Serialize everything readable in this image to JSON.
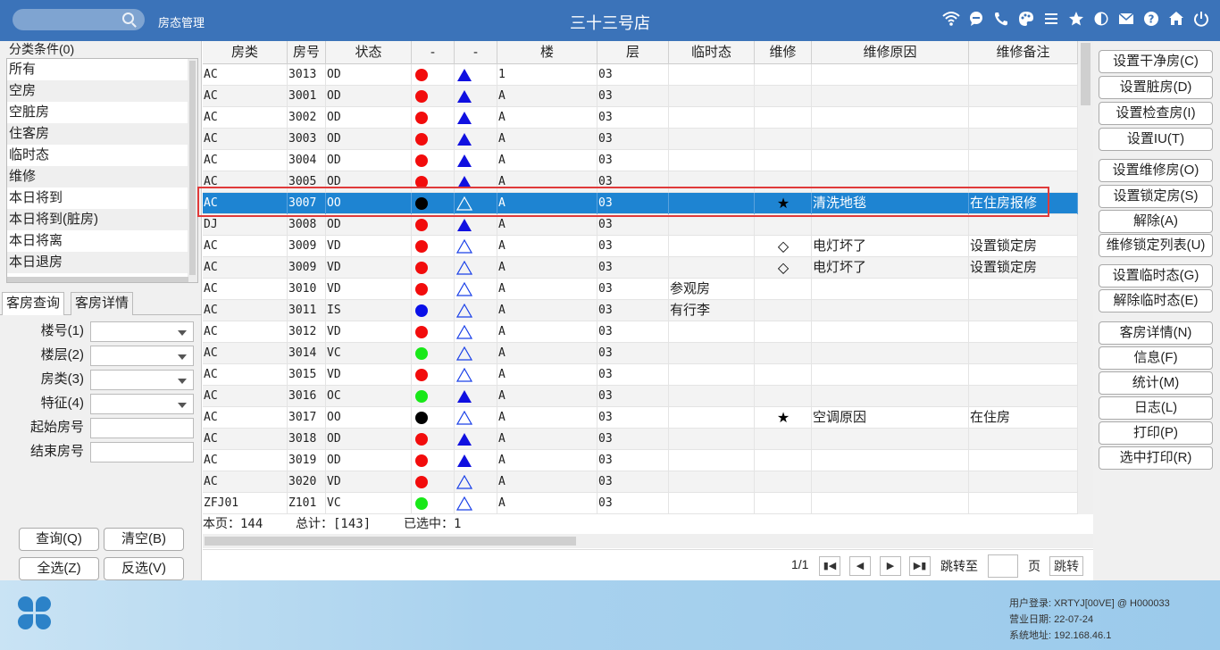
{
  "topbar": {
    "module": "房态管理",
    "store": "三十三号店",
    "icons": [
      "wifi-icon",
      "chat-icon",
      "phone-icon",
      "palette-icon",
      "menu-icon",
      "star-icon",
      "theme-icon",
      "mail-icon",
      "help-icon",
      "home-icon",
      "power-icon"
    ]
  },
  "left": {
    "category_title": "分类条件(0)",
    "categories": [
      "所有",
      "空房",
      "空脏房",
      "住客房",
      "临时态",
      "维修",
      "本日将到",
      "本日将到(脏房)",
      "本日将离",
      "本日退房"
    ],
    "tabs": [
      "客房查询",
      "客房详情"
    ],
    "fields": {
      "building": "楼号(1)",
      "floor": "楼层(2)",
      "room_type": "房类(3)",
      "feature": "特征(4)",
      "start_room": "起始房号",
      "end_room": "结束房号"
    },
    "buttons": {
      "query": "查询(Q)",
      "clear": "清空(B)",
      "select_all": "全选(Z)",
      "invert": "反选(V)"
    }
  },
  "grid": {
    "headers": [
      "房类",
      "房号",
      "状态",
      "-",
      "-",
      "楼",
      "层",
      "临时态",
      "维修",
      "维修原因",
      "维修备注"
    ],
    "rows": [
      {
        "type": "AC",
        "room": "3013",
        "status": "OD",
        "dot": "red",
        "tri": "filled",
        "building": "1",
        "floor": "03",
        "temp": "",
        "repair": "",
        "reason": "",
        "note": ""
      },
      {
        "type": "AC",
        "room": "3001",
        "status": "OD",
        "dot": "red",
        "tri": "filled",
        "building": "A",
        "floor": "03",
        "temp": "",
        "repair": "",
        "reason": "",
        "note": ""
      },
      {
        "type": "AC",
        "room": "3002",
        "status": "OD",
        "dot": "red",
        "tri": "filled",
        "building": "A",
        "floor": "03",
        "temp": "",
        "repair": "",
        "reason": "",
        "note": ""
      },
      {
        "type": "AC",
        "room": "3003",
        "status": "OD",
        "dot": "red",
        "tri": "filled",
        "building": "A",
        "floor": "03",
        "temp": "",
        "repair": "",
        "reason": "",
        "note": ""
      },
      {
        "type": "AC",
        "room": "3004",
        "status": "OD",
        "dot": "red",
        "tri": "filled",
        "building": "A",
        "floor": "03",
        "temp": "",
        "repair": "",
        "reason": "",
        "note": ""
      },
      {
        "type": "AC",
        "room": "3005",
        "status": "OD",
        "dot": "red",
        "tri": "filled",
        "building": "A",
        "floor": "03",
        "temp": "",
        "repair": "",
        "reason": "",
        "note": ""
      },
      {
        "type": "AC",
        "room": "3007",
        "status": "OO",
        "dot": "black",
        "tri": "outline",
        "building": "A",
        "floor": "03",
        "temp": "",
        "repair": "★",
        "reason": "清洗地毯",
        "note": "在住房报修",
        "selected": true
      },
      {
        "type": "DJ",
        "room": "3008",
        "status": "OD",
        "dot": "red",
        "tri": "filled",
        "building": "A",
        "floor": "03",
        "temp": "",
        "repair": "",
        "reason": "",
        "note": ""
      },
      {
        "type": "AC",
        "room": "3009",
        "status": "VD",
        "dot": "red",
        "tri": "outline",
        "building": "A",
        "floor": "03",
        "temp": "",
        "repair": "◇",
        "reason": "电灯坏了",
        "note": "设置锁定房"
      },
      {
        "type": "AC",
        "room": "3009",
        "status": "VD",
        "dot": "red",
        "tri": "outline",
        "building": "A",
        "floor": "03",
        "temp": "",
        "repair": "◇",
        "reason": "电灯坏了",
        "note": "设置锁定房"
      },
      {
        "type": "AC",
        "room": "3010",
        "status": "VD",
        "dot": "red",
        "tri": "outline",
        "building": "A",
        "floor": "03",
        "temp": "参观房",
        "repair": "",
        "reason": "",
        "note": ""
      },
      {
        "type": "AC",
        "room": "3011",
        "status": "IS",
        "dot": "blue",
        "tri": "outline",
        "building": "A",
        "floor": "03",
        "temp": "有行李",
        "repair": "",
        "reason": "",
        "note": ""
      },
      {
        "type": "AC",
        "room": "3012",
        "status": "VD",
        "dot": "red",
        "tri": "outline",
        "building": "A",
        "floor": "03",
        "temp": "",
        "repair": "",
        "reason": "",
        "note": ""
      },
      {
        "type": "AC",
        "room": "3014",
        "status": "VC",
        "dot": "green",
        "tri": "outline",
        "building": "A",
        "floor": "03",
        "temp": "",
        "repair": "",
        "reason": "",
        "note": ""
      },
      {
        "type": "AC",
        "room": "3015",
        "status": "VD",
        "dot": "red",
        "tri": "outline",
        "building": "A",
        "floor": "03",
        "temp": "",
        "repair": "",
        "reason": "",
        "note": ""
      },
      {
        "type": "AC",
        "room": "3016",
        "status": "OC",
        "dot": "green",
        "tri": "filled",
        "building": "A",
        "floor": "03",
        "temp": "",
        "repair": "",
        "reason": "",
        "note": ""
      },
      {
        "type": "AC",
        "room": "3017",
        "status": "OO",
        "dot": "black",
        "tri": "outline",
        "building": "A",
        "floor": "03",
        "temp": "",
        "repair": "★",
        "reason": "空调原因",
        "note": "在住房"
      },
      {
        "type": "AC",
        "room": "3018",
        "status": "OD",
        "dot": "red",
        "tri": "filled",
        "building": "A",
        "floor": "03",
        "temp": "",
        "repair": "",
        "reason": "",
        "note": ""
      },
      {
        "type": "AC",
        "room": "3019",
        "status": "OD",
        "dot": "red",
        "tri": "filled",
        "building": "A",
        "floor": "03",
        "temp": "",
        "repair": "",
        "reason": "",
        "note": ""
      },
      {
        "type": "AC",
        "room": "3020",
        "status": "VD",
        "dot": "red",
        "tri": "outline",
        "building": "A",
        "floor": "03",
        "temp": "",
        "repair": "",
        "reason": "",
        "note": ""
      },
      {
        "type": "ZFJ01",
        "room": "Z101",
        "status": "VC",
        "dot": "green",
        "tri": "outline",
        "building": "A",
        "floor": "03",
        "temp": "",
        "repair": "",
        "reason": "",
        "note": ""
      }
    ]
  },
  "summary": {
    "page_count": "本页：144",
    "total": "总计：[143]",
    "selected": "已选中：1"
  },
  "pager": {
    "page": "1/1",
    "jump_label": "跳转至",
    "page_unit": "页",
    "jump_button": "跳转"
  },
  "right_buttons": [
    "设置干净房(C)",
    "设置脏房(D)",
    "设置检查房(I)",
    "设置IU(T)",
    "设置维修房(O)",
    "设置锁定房(S)",
    "解除(A)",
    "维修锁定列表(U)",
    "设置临时态(G)",
    "解除临时态(E)",
    "客房详情(N)",
    "信息(F)",
    "统计(M)",
    "日志(L)",
    "打印(P)",
    "选中打印(R)"
  ],
  "footer": {
    "user": "用户登录:  XRTYJ[00VE] @ H000033",
    "business_date": "营业日期:  22-07-24",
    "system_address": "系统地址:  192.168.46.1"
  },
  "colors": {
    "red": "#f20c0c",
    "black": "#000000",
    "blue": "#0a10e8",
    "green": "#18e818",
    "accent": "#3b73b9",
    "selected_row": "#1e84d2"
  }
}
